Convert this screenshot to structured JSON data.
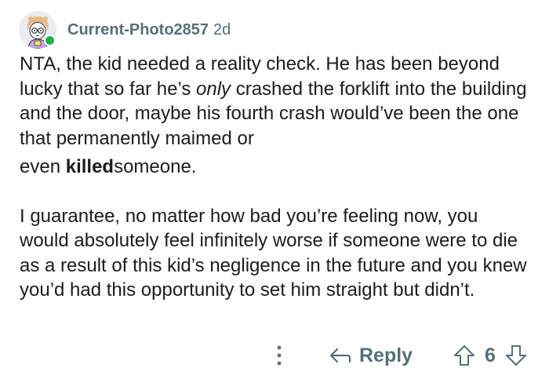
{
  "comment": {
    "username": "Current-Photo2857",
    "timestamp": "2d",
    "online": true,
    "paragraph1": {
      "lead": "NTA, the kid needed a reality check. He has been beyond lucky that so far he’s ",
      "emphasis": "only",
      "line_rest": " crashed the forklift into the building and the door, maybe his fourth crash would’ve been the one that permanently maimed or",
      "last_line_start": "even ",
      "bold_word": "killed",
      "last_line_end": "someone."
    },
    "paragraph2": "I guarantee, no matter how bad you’re feeling now, you would absolutely feel infinitely worse if someone were to die as a result of this kid’s negligence in the future and you knew you’d had this opportunity to set him straight but didn’t."
  },
  "actions": {
    "more_icon": "more-vertical-icon",
    "reply_icon": "reply-arrow-icon",
    "reply_label": "Reply",
    "upvote_icon": "upvote-arrow-icon",
    "score": "6",
    "downvote_icon": "downvote-arrow-icon"
  },
  "colors": {
    "text": "#1c1c1c",
    "meta": "#576f76",
    "online": "#1fb24a"
  }
}
